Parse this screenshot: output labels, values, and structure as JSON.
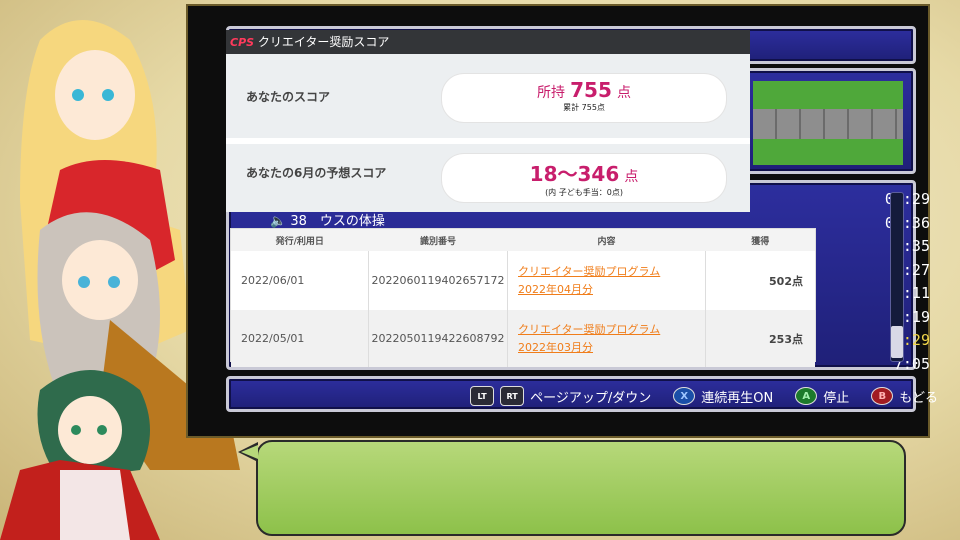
{
  "score_window": {
    "title": "クリエイター奨励スコア",
    "logo": "CPS",
    "row1_label": "あなたのスコア",
    "row1_prefix": "所持",
    "row1_value": "755",
    "row1_unit": "点",
    "row1_sub": "累計 755点",
    "row2_label": "あなたの6月の予想スコア",
    "row2_value": "18～346",
    "row2_unit": "点",
    "row2_sub": "(内 子ども手当：0点)"
  },
  "table": {
    "headers": [
      "発行/利用日",
      "識別番号",
      "内容",
      "獲得"
    ],
    "rows": [
      {
        "date": "2022/06/01",
        "id": "2022060119402657172",
        "desc1": "クリエイター奨励プログラム",
        "desc2": "2022年04月分",
        "points": "502点"
      },
      {
        "date": "2022/05/01",
        "id": "2022050119422608792",
        "desc1": "クリエイター奨励プログラム",
        "desc2": "2022年03月分",
        "points": "253点"
      }
    ]
  },
  "game": {
    "list_item": "38　ウスの体操",
    "times": [
      "00:29",
      "00:36",
      "1:35",
      "1:27",
      "2:11",
      "2:19",
      "0:29",
      "7:05"
    ],
    "highlight_index": 6
  },
  "hints": {
    "lt": "LT",
    "rt": "RT",
    "page_label": "ページアップ/ダウン",
    "x": "X",
    "x_label": "連続再生ON",
    "a": "A",
    "a_label": "停止",
    "b": "B",
    "b_label": "もどる"
  },
  "colors": {
    "accent": "#c81e6c",
    "link": "#f07d1a",
    "bubble": "#9ccb5a",
    "panel": "#2d2e9e"
  },
  "icons": [
    "cps-logo-icon",
    "lt-button-icon",
    "rt-button-icon",
    "x-button-icon",
    "a-button-icon",
    "b-button-icon",
    "speaker-icon"
  ]
}
